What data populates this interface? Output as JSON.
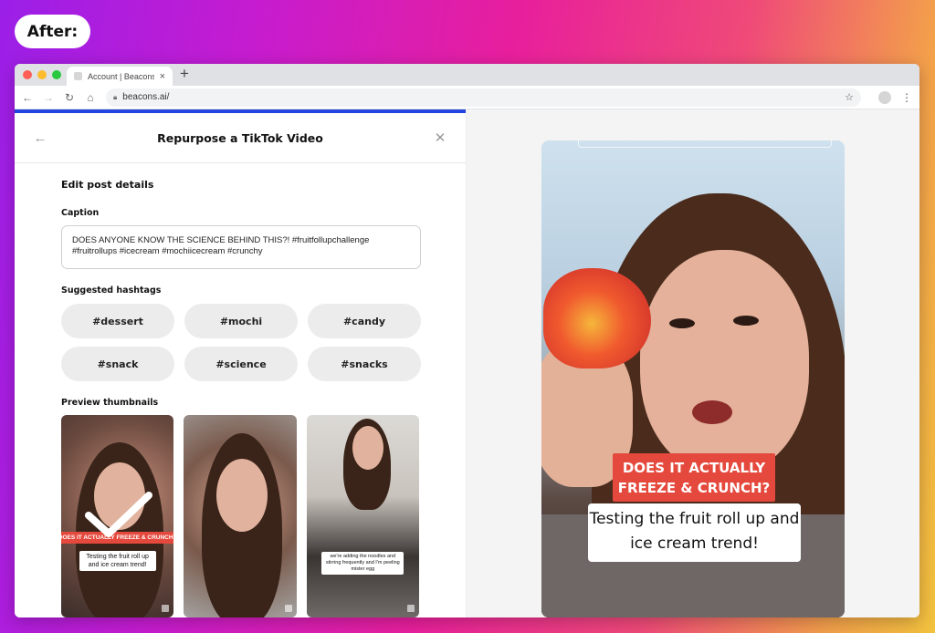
{
  "badge": {
    "label": "After:"
  },
  "browser": {
    "tab_title": "Account | Beacons",
    "url": "beacons.ai/",
    "colors": {
      "close": "#ff5f57",
      "minimize": "#febc2e",
      "maximize": "#28c840"
    }
  },
  "modal": {
    "title": "Repurpose a TikTok Video",
    "section_title": "Edit post details",
    "caption_label": "Caption",
    "caption_value": "DOES ANYONE KNOW THE SCIENCE BEHIND THIS?! #fruitfollupchallenge #fruitrollups #icecream #mochiicecream #crunchy",
    "hashtags_label": "Suggested hashtags",
    "hashtags": [
      "#dessert",
      "#mochi",
      "#candy",
      "#snack",
      "#science",
      "#snacks"
    ],
    "thumbnails_label": "Preview thumbnails",
    "thumbnails": [
      {
        "overlay_top": "DOES IT ACTUALLY FREEZE & CRUNCH?",
        "overlay_bottom": "Testing the fruit roll up and ice cream trend!",
        "selected": true
      },
      {
        "overlay_top": "",
        "overlay_bottom": "",
        "selected": false
      },
      {
        "overlay_top": "",
        "overlay_bottom": "we're adding the noodles and stirring frequently and I'm peeling mister egg",
        "selected": false
      }
    ]
  },
  "preview": {
    "overlay_top": "DOES IT ACTUALLY FREEZE & CRUNCH?",
    "overlay_bottom": "Testing the fruit roll up and ice cream trend!"
  }
}
